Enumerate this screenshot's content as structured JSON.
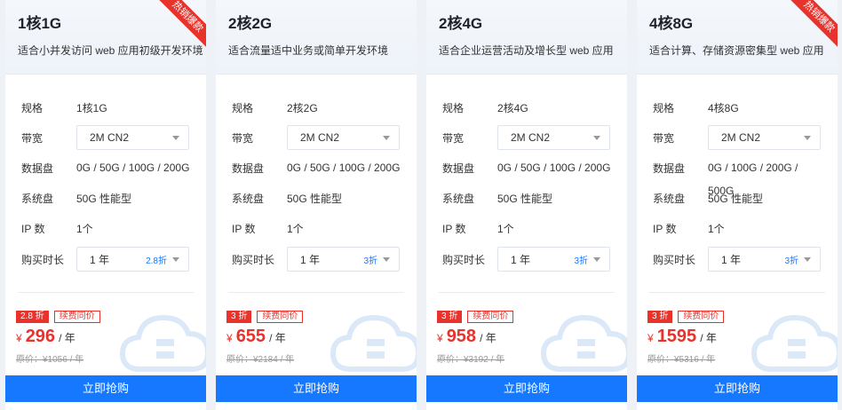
{
  "labels": {
    "spec": "规格",
    "bandwidth": "带宽",
    "data_disk": "数据盘",
    "sys_disk": "系统盘",
    "ip": "IP 数",
    "duration": "购买时长",
    "renew": "续费同价",
    "buy": "立即抢购",
    "per_year": "/ 年",
    "currency": "¥",
    "hot": "热销爆款"
  },
  "cards": [
    {
      "title": "1核1G",
      "desc": "适合小并发访问 web 应用初级开发环境",
      "hot": true,
      "spec": "1核1G",
      "bandwidth": "2M CN2",
      "data_disk": "0G / 50G / 100G / 200G",
      "sys_disk": "50G 性能型",
      "ip": "1个",
      "duration": "1 年",
      "duration_discount": "2.8折",
      "discount_badge": "2.8 折",
      "price": "296",
      "original_price": "原价：¥1056 / 年"
    },
    {
      "title": "2核2G",
      "desc": "适合流量适中业务或简单开发环境",
      "hot": false,
      "spec": "2核2G",
      "bandwidth": "2M CN2",
      "data_disk": "0G / 50G / 100G / 200G",
      "sys_disk": "50G 性能型",
      "ip": "1个",
      "duration": "1 年",
      "duration_discount": "3折",
      "discount_badge": "3 折",
      "price": "655",
      "original_price": "原价：¥2184 / 年"
    },
    {
      "title": "2核4G",
      "desc": "适合企业运营活动及增长型 web 应用",
      "hot": false,
      "spec": "2核4G",
      "bandwidth": "2M CN2",
      "data_disk": "0G / 50G / 100G / 200G",
      "sys_disk": "50G 性能型",
      "ip": "1个",
      "duration": "1 年",
      "duration_discount": "3折",
      "discount_badge": "3 折",
      "price": "958",
      "original_price": "原价：¥3192 / 年"
    },
    {
      "title": "4核8G",
      "desc": "适合计算、存储资源密集型 web 应用",
      "hot": true,
      "spec": "4核8G",
      "bandwidth": "2M CN2",
      "data_disk": "0G / 100G / 200G / 500G",
      "sys_disk": "50G 性能型",
      "ip": "1个",
      "duration": "1 年",
      "duration_discount": "3折",
      "discount_badge": "3 折",
      "price": "1595",
      "original_price": "原价：¥5316 / 年"
    }
  ]
}
